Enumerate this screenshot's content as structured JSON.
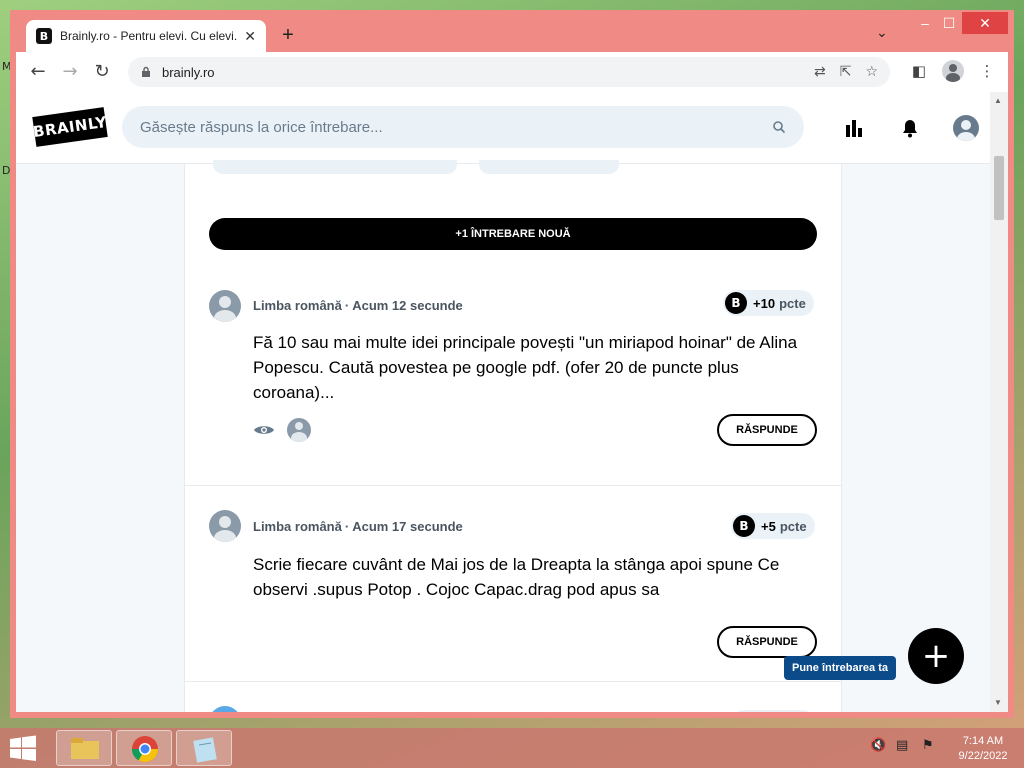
{
  "browser": {
    "tab_title": "Brainly.ro - Pentru elevi. Cu elevi.",
    "tab_favicon": "B",
    "url": "brainly.ro"
  },
  "header": {
    "logo_text": "BRAINLY",
    "search_placeholder": "Găsește răspuns la orice întrebare..."
  },
  "feed": {
    "new_question_label": "+1 ÎNTREBARE NOUĂ",
    "questions": [
      {
        "subject": "Limba română",
        "time": "Acum 12 secunde",
        "points": "+10",
        "points_unit": "pcte",
        "text": "Fă 10 sau mai multe idei principale povești \"un miriapod hoinar\" de Alina Popescu. Caută povestea pe google pdf. (ofer 20 de puncte plus coroana)...",
        "answer_label": "RĂSPUNDE"
      },
      {
        "subject": "Limba română",
        "time": "Acum 17 secunde",
        "points": "+5",
        "points_unit": "pcte",
        "text": "Scrie fiecare cuvânt de Mai jos de la Dreapta la stânga apoi spune Ce observi .supus Potop . Cojoc Capac.drag pod apus sa",
        "answer_label": "RĂSPUNDE"
      }
    ]
  },
  "fab": {
    "label": "Pune întrebarea ta",
    "icon": "+"
  },
  "taskbar": {
    "time": "7:14 AM",
    "date": "9/22/2022"
  },
  "desktop": {
    "letters": [
      "M",
      "D"
    ]
  }
}
